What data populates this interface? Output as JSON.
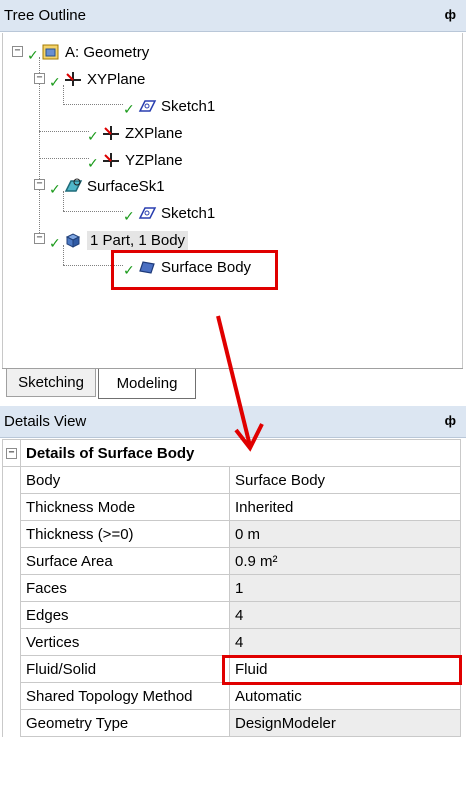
{
  "tree_outline": {
    "title": "Tree Outline",
    "pin": "ф",
    "nodes": {
      "geometry": "A: Geometry",
      "xyplane": "XYPlane",
      "sketch1a": "Sketch1",
      "zxplane": "ZXPlane",
      "yzplane": "YZPlane",
      "surfacesk1": "SurfaceSk1",
      "sketch1b": "Sketch1",
      "part": "1 Part, 1 Body",
      "surface_body": "Surface Body"
    },
    "tabs": [
      "Sketching",
      "Modeling"
    ]
  },
  "details_view": {
    "title": "Details View",
    "pin": "ф",
    "header": "Details of Surface Body",
    "rows": [
      {
        "label": "Body",
        "value": "Surface Body"
      },
      {
        "label": "Thickness Mode",
        "value": "Inherited"
      },
      {
        "label": "Thickness (>=0)",
        "value": "0 m"
      },
      {
        "label": "Surface Area",
        "value": "0.9 m²"
      },
      {
        "label": "Faces",
        "value": "1"
      },
      {
        "label": "Edges",
        "value": "4"
      },
      {
        "label": "Vertices",
        "value": "4"
      },
      {
        "label": "Fluid/Solid",
        "value": "Fluid"
      },
      {
        "label": "Shared Topology Method",
        "value": "Automatic"
      },
      {
        "label": "Geometry Type",
        "value": "DesignModeler"
      }
    ]
  },
  "colors": {
    "highlight": "#e00000",
    "title_bar": "#dce6f2",
    "check": "#1a9a1a"
  }
}
